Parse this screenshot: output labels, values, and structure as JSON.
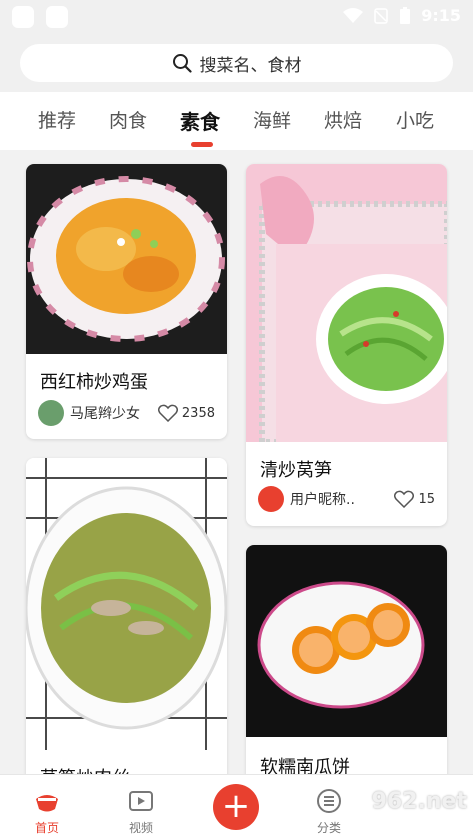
{
  "status_bar": {
    "time": "9:15"
  },
  "search": {
    "placeholder": "搜菜名、食材"
  },
  "tabs": [
    "推荐",
    "肉食",
    "素食",
    "海鲜",
    "烘焙",
    "小吃"
  ],
  "active_tab": "素食",
  "feed": {
    "cards": [
      {
        "title": "西红柿炒鸡蛋",
        "author": "马尾辫少女",
        "likes": "2358"
      },
      {
        "title": "清炒莴笋",
        "author": "用户昵称..",
        "likes": "15"
      },
      {
        "title": "莴笋炒肉丝"
      },
      {
        "title": "软糯南瓜饼"
      }
    ]
  },
  "bottom_nav": {
    "home": "首页",
    "video": "视频",
    "category": "分类"
  },
  "watermark": "962.net",
  "colors": {
    "accent": "#e8402f"
  }
}
